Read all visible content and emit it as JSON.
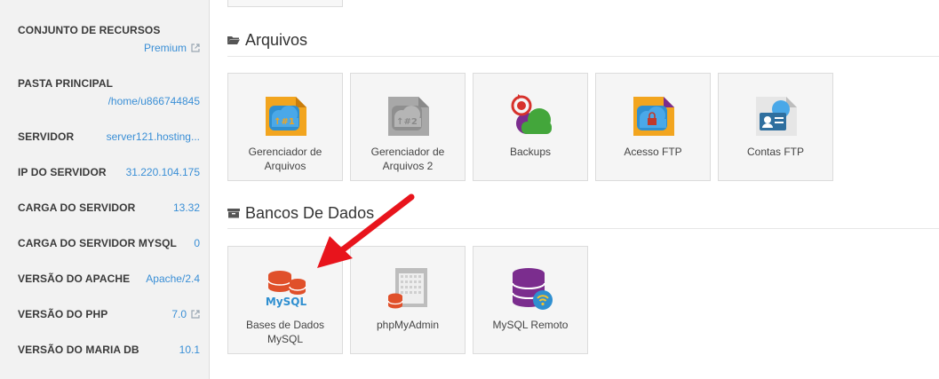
{
  "sidebar": {
    "items": [
      {
        "label": "CONJUNTO DE RECURSOS",
        "value": "Premium"
      },
      {
        "label": "PASTA PRINCIPAL",
        "value": "/home/u866744845"
      },
      {
        "label": "SERVIDOR",
        "value": "server121.hosting..."
      },
      {
        "label": "IP DO SERVIDOR",
        "value": "31.220.104.175"
      },
      {
        "label": "CARGA DO SERVIDOR",
        "value": "13.32"
      },
      {
        "label": "CARGA DO SERVIDOR MYSQL",
        "value": "0"
      },
      {
        "label": "VERSÃO DO APACHE",
        "value": "Apache/2.4"
      },
      {
        "label": "VERSÃO DO PHP",
        "value": "7.0"
      },
      {
        "label": "VERSÃO DO MARIA DB",
        "value": "10.1"
      }
    ]
  },
  "sections": {
    "arquivos": {
      "title": "Arquivos",
      "tiles": [
        {
          "label": "Gerenciador de Arquivos",
          "icon": "file-manager-icon"
        },
        {
          "label": "Gerenciador de Arquivos 2",
          "icon": "file-manager-2-icon"
        },
        {
          "label": "Backups",
          "icon": "backups-icon"
        },
        {
          "label": "Acesso FTP",
          "icon": "ftp-access-icon"
        },
        {
          "label": "Contas FTP",
          "icon": "ftp-accounts-icon"
        }
      ]
    },
    "bancos": {
      "title": "Bancos De Dados",
      "tiles": [
        {
          "label": "Bases de Dados MySQL",
          "icon": "mysql-databases-icon"
        },
        {
          "label": "phpMyAdmin",
          "icon": "phpmyadmin-icon"
        },
        {
          "label": "MySQL Remoto",
          "icon": "mysql-remote-icon"
        }
      ]
    }
  },
  "colors": {
    "accent_link": "#3a8fd6",
    "arrow": "#e8141c",
    "mysql_red": "#e0502a",
    "mysql_blue": "#2f8fd0",
    "purple": "#7b2d8e",
    "orange": "#f2a51f"
  }
}
